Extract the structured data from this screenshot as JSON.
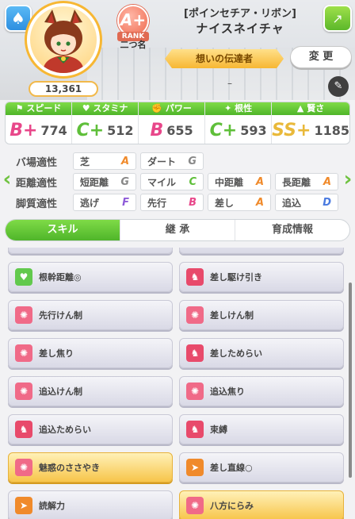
{
  "header": {
    "fans": "13,361",
    "rank": "A+",
    "rank_label": "RANK",
    "nickname_short": "二つ名",
    "costume": "[ポインセチア・リボン]",
    "name": "ナイスネイチャ",
    "title": "想いの伝達者",
    "change_label": "変 更",
    "dash": "–"
  },
  "stats": [
    {
      "label": "スピード",
      "icon": "shoe-icon",
      "grade": "B+",
      "value": "774",
      "color": "#e8478a"
    },
    {
      "label": "スタミナ",
      "icon": "heart-icon",
      "grade": "C+",
      "value": "512",
      "color": "#5fbf3a"
    },
    {
      "label": "パワー",
      "icon": "muscle-icon",
      "grade": "B",
      "value": "655",
      "color": "#e8478a"
    },
    {
      "label": "根性",
      "icon": "fire-icon",
      "grade": "C+",
      "value": "593",
      "color": "#5fbf3a"
    },
    {
      "label": "賢さ",
      "icon": "graduation-cap-icon",
      "grade": "SS+",
      "value": "1185",
      "color": "#e9b93a"
    }
  ],
  "aptitude": {
    "track_label": "バ場適性",
    "distance_label": "距離適性",
    "style_label": "脚質適性",
    "track": [
      {
        "name": "芝",
        "grade": "A",
        "color": "#f08a2b"
      },
      {
        "name": "ダート",
        "grade": "G",
        "color": "#888888"
      }
    ],
    "distance": [
      {
        "name": "短距離",
        "grade": "G",
        "color": "#888888"
      },
      {
        "name": "マイル",
        "grade": "C",
        "color": "#5fbf3a"
      },
      {
        "name": "中距離",
        "grade": "A",
        "color": "#f08a2b"
      },
      {
        "name": "長距離",
        "grade": "A",
        "color": "#f08a2b"
      }
    ],
    "style": [
      {
        "name": "逃げ",
        "grade": "F",
        "color": "#8e5bd8"
      },
      {
        "name": "先行",
        "grade": "B",
        "color": "#e8478a"
      },
      {
        "name": "差し",
        "grade": "A",
        "color": "#f08a2b"
      },
      {
        "name": "追込",
        "grade": "D",
        "color": "#4a7ae0"
      }
    ]
  },
  "tabs": [
    "スキル",
    "継 承",
    "育成情報"
  ],
  "skills": [
    {
      "name": "根幹距離◎",
      "icon": "heart-icon",
      "style": "normal",
      "icon_color": "#62c94d"
    },
    {
      "name": "差し駆け引き",
      "icon": "horse-icon",
      "style": "normal",
      "icon_color": "#e84a6b"
    },
    {
      "name": "先行けん制",
      "icon": "burst-icon",
      "style": "normal",
      "icon_color": "#f06a88"
    },
    {
      "name": "差しけん制",
      "icon": "burst-icon",
      "style": "normal",
      "icon_color": "#f06a88"
    },
    {
      "name": "差し焦り",
      "icon": "burst-icon",
      "style": "normal",
      "icon_color": "#f06a88"
    },
    {
      "name": "差しためらい",
      "icon": "horse-icon",
      "style": "normal",
      "icon_color": "#e84a6b"
    },
    {
      "name": "追込けん制",
      "icon": "burst-icon",
      "style": "normal",
      "icon_color": "#f06a88"
    },
    {
      "name": "追込焦り",
      "icon": "burst-icon",
      "style": "normal",
      "icon_color": "#f06a88"
    },
    {
      "name": "追込ためらい",
      "icon": "horse-icon",
      "style": "normal",
      "icon_color": "#e84a6b"
    },
    {
      "name": "束縛",
      "icon": "horse-icon",
      "style": "normal",
      "icon_color": "#e84a6b"
    },
    {
      "name": "魅惑のささやき",
      "icon": "burst-icon",
      "style": "gold",
      "icon_color": "#f06a88"
    },
    {
      "name": "差し直線○",
      "icon": "runner-icon",
      "style": "normal",
      "icon_color": "#f08a2b"
    },
    {
      "name": "読解力",
      "icon": "runner-icon",
      "style": "normal",
      "icon_color": "#f08a2b"
    },
    {
      "name": "八方にらみ",
      "icon": "burst-icon",
      "style": "gold",
      "icon_color": "#f06a88"
    }
  ]
}
